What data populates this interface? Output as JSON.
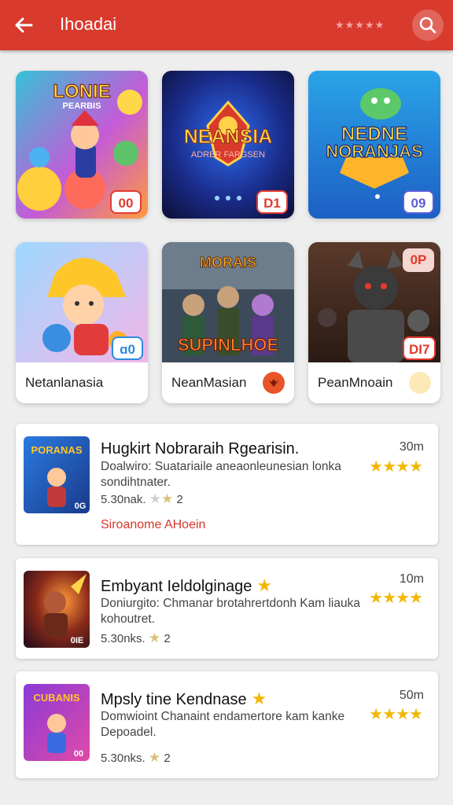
{
  "appbar": {
    "title": "Ihoadai",
    "deco_stars": "★★★★★",
    "back_icon": "arrow-left-icon",
    "search_icon": "search-icon",
    "color": "#d93a2e"
  },
  "grid": [
    {
      "name": "",
      "badge": "00",
      "art_title": "LONIE",
      "art_subtitle": "PEARBIS"
    },
    {
      "name": "",
      "badge": "D1",
      "art_title": "NEANSIA",
      "art_subtitle": "ADRER FARGSEN"
    },
    {
      "name": "",
      "badge": "09",
      "art_title": "NEDNE",
      "art_subtitle": "NORANJAS"
    },
    {
      "name": "Netanlanasia",
      "badge": "ɑ0",
      "art_title": "",
      "art_subtitle": ""
    },
    {
      "name": "NeanMasian",
      "badge": "",
      "art_title": "MORAIS",
      "art_subtitle": "SUPINLHOE"
    },
    {
      "name": "PeanMnoain",
      "badge": "DI7",
      "badge2": "0P",
      "art_title": "",
      "art_subtitle": ""
    }
  ],
  "list": [
    {
      "title": "Hugkirt Nobraraih Rgearisin.",
      "time": "30m",
      "desc": "Doalwiro: Suatariaile aneaonleunesian lonka sondihtnater.",
      "rating": "★★★★",
      "meta": "5.30nak.",
      "meta_num": "2",
      "link": "Siroanome AHoein",
      "thumb_title": "PORANAS",
      "thumb_tag": "0G"
    },
    {
      "title": "Embyant Ieldolginage",
      "time": "10m",
      "desc": "Doniurgito: Chmanar brotahrertdonh Kam liauka kohoutret.",
      "rating": "★★★★",
      "meta": "5.30nks.",
      "meta_num": "2",
      "link": "",
      "thumb_title": "",
      "thumb_tag": "0IE"
    },
    {
      "title": "Mpsly tine Kendnase",
      "time": "50m",
      "desc": "Domwioint Chanaint endamertore kam kanke Depoadel.",
      "rating": "★★★★",
      "meta": "5.30nks.",
      "meta_num": "2",
      "link": "",
      "thumb_title": "CUBANIS",
      "thumb_tag": "00"
    }
  ]
}
